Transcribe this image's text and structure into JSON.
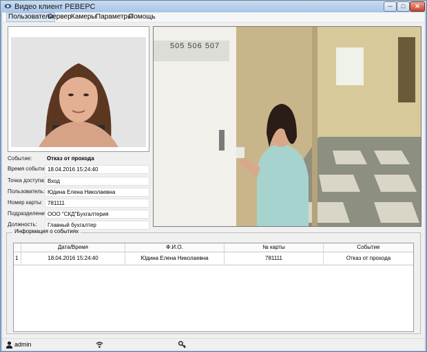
{
  "window": {
    "title": "Видео клиент РЕВЕРС"
  },
  "menu": [
    {
      "label": "Пользователи",
      "active": true
    },
    {
      "label": "Сервер"
    },
    {
      "label": "Камеры"
    },
    {
      "label": "Параметры"
    },
    {
      "label": "Помощь"
    }
  ],
  "details": [
    {
      "label": "Событие:",
      "value": "Отказ от прохода"
    },
    {
      "label": "Время события:",
      "value": "18.04.2016 15:24:40"
    },
    {
      "label": "Точка доступа:",
      "value": "Вход"
    },
    {
      "label": "Пользователь:",
      "value": "Юдина Елена Николаевна"
    },
    {
      "label": "Номер карты:",
      "value": "781111"
    },
    {
      "label": "Подразделение:",
      "value": "ООО \"СКД\"Бухгалтерия"
    },
    {
      "label": "Должность:",
      "value": "Главный бухгалтер"
    }
  ],
  "camera": {
    "door_numbers": "505 506 507"
  },
  "events": {
    "caption": "Информация о событиях",
    "columns": [
      "",
      "Дата/Время",
      "Ф.И.О.",
      "№ карты",
      "Событие"
    ],
    "rows": [
      [
        "1",
        "18.04.2016 15:24:40",
        "Юдина Елена Николаевна",
        "781111",
        "Отказ от прохода"
      ]
    ]
  },
  "status": {
    "user": "admin"
  },
  "colors": {
    "accent": "#a9c4e3",
    "close": "#c7452d"
  },
  "icons": {
    "user": "user-icon",
    "connection": "wifi-icon",
    "key": "key-icon"
  }
}
